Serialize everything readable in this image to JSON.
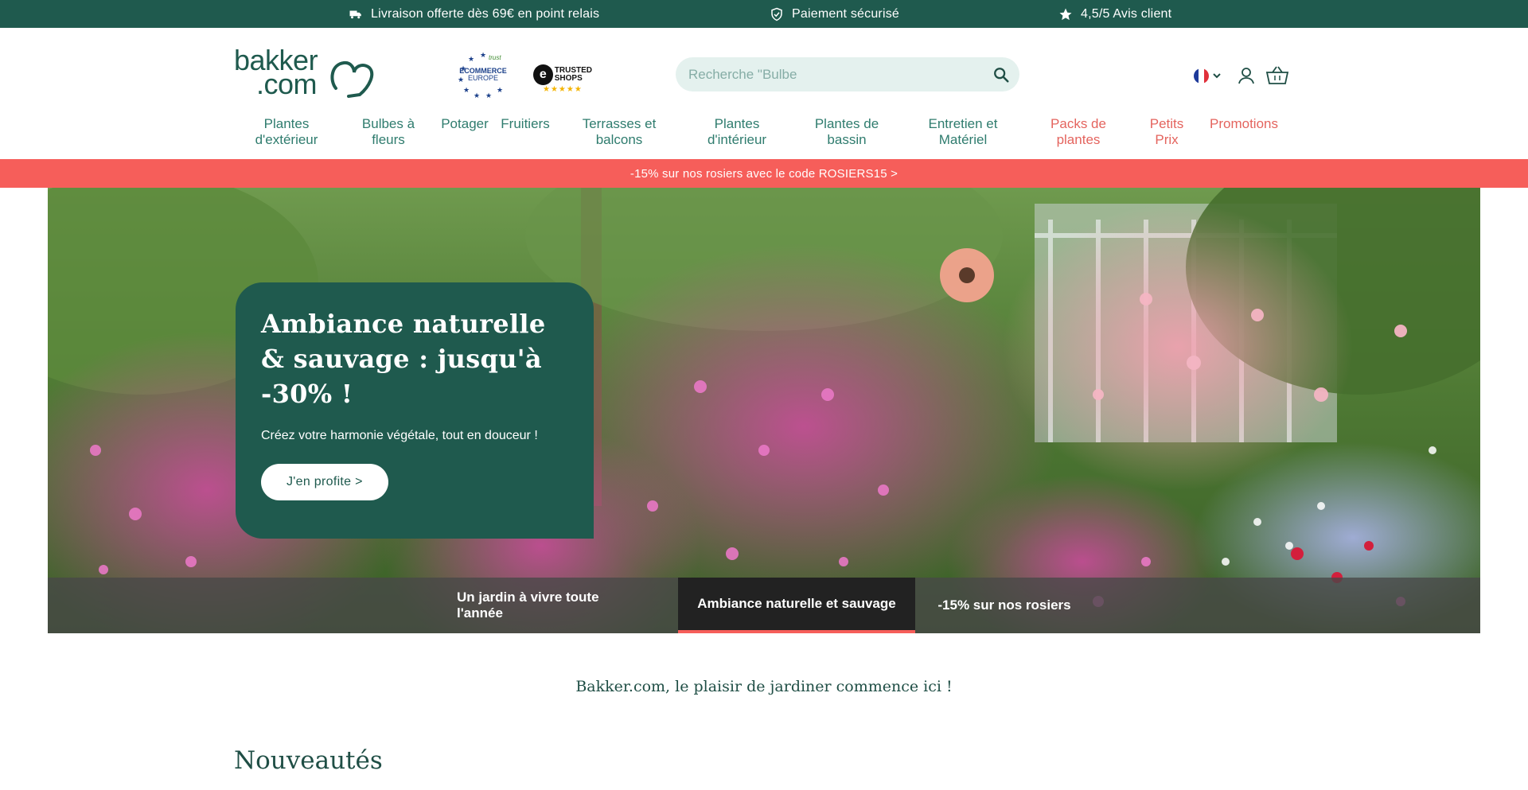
{
  "topbar": {
    "usps": [
      {
        "icon": "truck-icon",
        "text": "Livraison offerte dès 69€ en point relais"
      },
      {
        "icon": "shield-check-icon",
        "text": "Paiement sécurisé"
      },
      {
        "icon": "star-icon",
        "text": "4,5/5 Avis client"
      }
    ],
    "background": "#1f5a4e"
  },
  "header": {
    "logo_line1": "bakker",
    "logo_line2": ".com",
    "badges": {
      "eu_line1": "ECOMMERCE",
      "eu_line2": "EUROPE",
      "eu_top": "trust",
      "ts_symbol": "e",
      "ts_line1": "TRUSTED",
      "ts_line2": "SHOPS",
      "ts_stars": "★★★★★"
    },
    "search": {
      "placeholder": "Recherche \"Bulbe",
      "icon": "search-icon"
    },
    "icons": [
      "flag-fr-icon",
      "chevron-down-icon",
      "user-icon",
      "basket-icon"
    ]
  },
  "nav": {
    "items": [
      {
        "line1": "Plantes",
        "line2": "d'extérieur"
      },
      {
        "line1": "Bulbes à",
        "line2": "fleurs"
      },
      {
        "line1": "Potager",
        "line2": ""
      },
      {
        "line1": "Fruitiers",
        "line2": ""
      },
      {
        "line1": "Terrasses et",
        "line2": "balcons"
      },
      {
        "line1": "Plantes",
        "line2": "d'intérieur"
      },
      {
        "line1": "Plantes de",
        "line2": "bassin"
      },
      {
        "line1": "Entretien et",
        "line2": "Matériel"
      },
      {
        "line1": "Packs de",
        "line2": "plantes"
      },
      {
        "line1": "Petits",
        "line2": "Prix"
      },
      {
        "line1": "Promotions",
        "line2": ""
      }
    ],
    "promo_color": "#e4645e"
  },
  "promo_bar": {
    "text": "-15% sur nos rosiers avec le code ROSIERS15 >",
    "background": "#f65e5a"
  },
  "hero": {
    "title": "Ambiance naturelle & sauvage : jusqu'à -30% !",
    "subtitle": "Créez votre harmonie végétale, tout en douceur !",
    "cta": "J'en profite >",
    "tabs": [
      {
        "label": "Un jardin à vivre toute l'année",
        "active": false
      },
      {
        "label": "Ambiance naturelle et sauvage",
        "active": true
      },
      {
        "label": "-15% sur nos rosiers",
        "active": false
      }
    ]
  },
  "tagline": "Bakker.com, le plaisir de jardiner commence ici !",
  "section_title": "Nouveautés"
}
